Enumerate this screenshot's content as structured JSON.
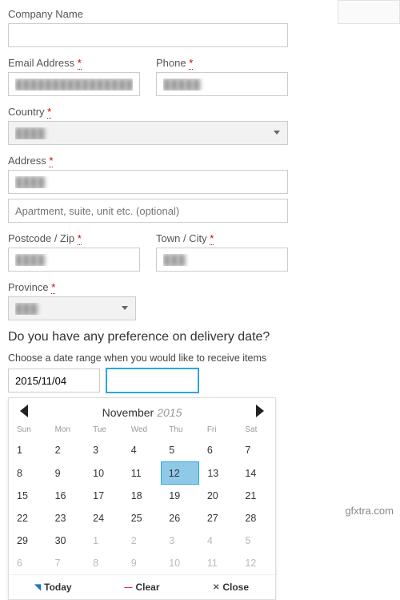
{
  "labels": {
    "company": "Company Name",
    "email": "Email Address",
    "phone": "Phone",
    "country": "Country",
    "address": "Address",
    "address2_ph": "Apartment, suite, unit etc. (optional)",
    "postcode": "Postcode / Zip",
    "city": "Town / City",
    "province": "Province",
    "required": "*"
  },
  "values": {
    "company": "",
    "email": "████████████████",
    "phone": "█████",
    "country": "████",
    "address1": "████",
    "address2": "",
    "postcode": "████",
    "city": "███",
    "province": "███",
    "date_from": "2015/11/04",
    "date_to": ""
  },
  "delivery": {
    "heading": "Do you have any preference on delivery date?",
    "range_label": "Choose a date range when you would like to receive items"
  },
  "calendar": {
    "month": "November",
    "year": "2015",
    "dow": [
      "Sun",
      "Mon",
      "Tue",
      "Wed",
      "Thu",
      "Fri",
      "Sat"
    ],
    "selected_day": 12,
    "weeks": [
      [
        {
          "d": 1
        },
        {
          "d": 2
        },
        {
          "d": 3
        },
        {
          "d": 4
        },
        {
          "d": 5
        },
        {
          "d": 6
        },
        {
          "d": 7
        }
      ],
      [
        {
          "d": 8
        },
        {
          "d": 9
        },
        {
          "d": 10
        },
        {
          "d": 11
        },
        {
          "d": 12,
          "sel": true
        },
        {
          "d": 13
        },
        {
          "d": 14
        }
      ],
      [
        {
          "d": 15
        },
        {
          "d": 16
        },
        {
          "d": 17
        },
        {
          "d": 18
        },
        {
          "d": 19
        },
        {
          "d": 20
        },
        {
          "d": 21
        }
      ],
      [
        {
          "d": 22
        },
        {
          "d": 23
        },
        {
          "d": 24
        },
        {
          "d": 25
        },
        {
          "d": 26
        },
        {
          "d": 27
        },
        {
          "d": 28
        }
      ],
      [
        {
          "d": 29
        },
        {
          "d": 30
        },
        {
          "d": 1,
          "o": true
        },
        {
          "d": 2,
          "o": true
        },
        {
          "d": 3,
          "o": true
        },
        {
          "d": 4,
          "o": true
        },
        {
          "d": 5,
          "o": true
        }
      ],
      [
        {
          "d": 6,
          "o": true
        },
        {
          "d": 7,
          "o": true
        },
        {
          "d": 8,
          "o": true
        },
        {
          "d": 9,
          "o": true
        },
        {
          "d": 10,
          "o": true
        },
        {
          "d": 11,
          "o": true
        },
        {
          "d": 12,
          "o": true
        }
      ]
    ],
    "buttons": {
      "today": "Today",
      "clear": "Clear",
      "close": "Close"
    }
  },
  "watermark": "gfxtra.com"
}
